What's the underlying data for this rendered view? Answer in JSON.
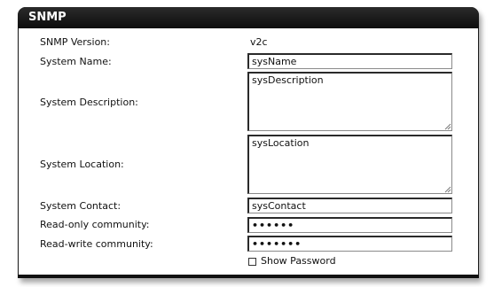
{
  "panel": {
    "title": "SNMP"
  },
  "fields": {
    "snmp_version": {
      "label": "SNMP Version:",
      "value": "v2c"
    },
    "system_name": {
      "label": "System Name:",
      "value": "sysName"
    },
    "system_description": {
      "label": "System Description:",
      "value": "sysDescription"
    },
    "system_location": {
      "label": "System Location:",
      "value": "sysLocation"
    },
    "system_contact": {
      "label": "System Contact:",
      "value": "sysContact"
    },
    "read_only_community": {
      "label": "Read-only community:",
      "value": "••••••"
    },
    "read_write_community": {
      "label": "Read-write community:",
      "value": "•••••••"
    }
  },
  "show_password": {
    "label": "Show Password",
    "checked": false
  }
}
